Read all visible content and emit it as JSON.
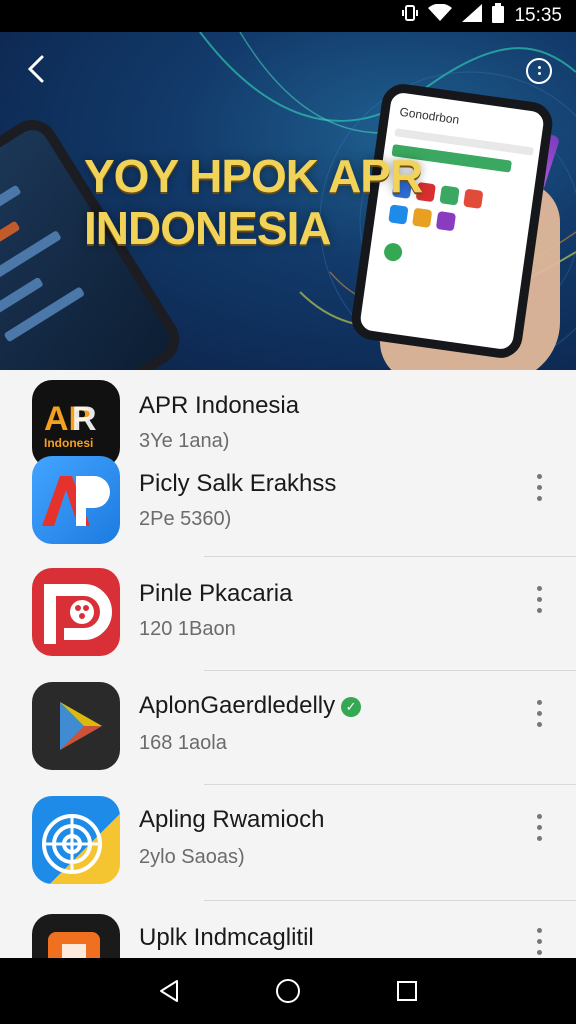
{
  "status_bar": {
    "time": "15:35",
    "icons": [
      "vibrate-icon",
      "wifi-icon",
      "signal-icon",
      "battery-icon"
    ]
  },
  "banner": {
    "headline_line1": "YOY HPOK APR",
    "headline_line2": "INDONESIA",
    "phone_screen_title": "Gonodrbon",
    "icons": {
      "back": "back-arrow-icon",
      "more": "more-options-icon"
    }
  },
  "apps": [
    {
      "name": "APR Indonesia",
      "meta": "3Ye 1ana)",
      "icon": "apr-logo",
      "icon_label": "Indonesi",
      "colors": {
        "bg": "#111111",
        "accent": "#f4a020"
      },
      "has_menu": false
    },
    {
      "name": "Picly Salk Erakhss",
      "meta": "2Pe 5360)",
      "icon": "ap-logo",
      "colors": {
        "bg": "#2f8ff0",
        "accent": "#e5322c"
      },
      "has_menu": true
    },
    {
      "name": "Pinle Pkacaria",
      "meta": "120 1Baon",
      "icon": "p-logo",
      "colors": {
        "bg": "#d93038",
        "accent": "#ffffff"
      },
      "has_menu": true
    },
    {
      "name": "AplonGaerdledelly",
      "meta": "168 1aola",
      "icon": "play-triangle-logo",
      "verified": true,
      "colors": {
        "bg": "#2a2a2a",
        "accent": "#34a853"
      },
      "has_menu": true
    },
    {
      "name": "Apling Rwamioch",
      "meta": "2ylo Saoas)",
      "icon": "target-logo",
      "colors": {
        "bg": "#1f8be8",
        "accent": "#f5c531"
      },
      "has_menu": true
    },
    {
      "name": "Uplk Indmcaglitil",
      "meta": "",
      "icon": "orange-logo",
      "colors": {
        "bg": "#1a1a1a",
        "accent": "#f07020"
      },
      "has_menu": true
    }
  ],
  "nav_bar": {
    "icons": [
      "back-triangle-icon",
      "home-circle-icon",
      "recents-square-icon"
    ]
  },
  "colors": {
    "banner_bg": "#0b1f45",
    "headline": "#f2d35a",
    "list_bg": "#f4f4f4",
    "text_primary": "#1a1a1a",
    "text_secondary": "#6b6b6b"
  }
}
